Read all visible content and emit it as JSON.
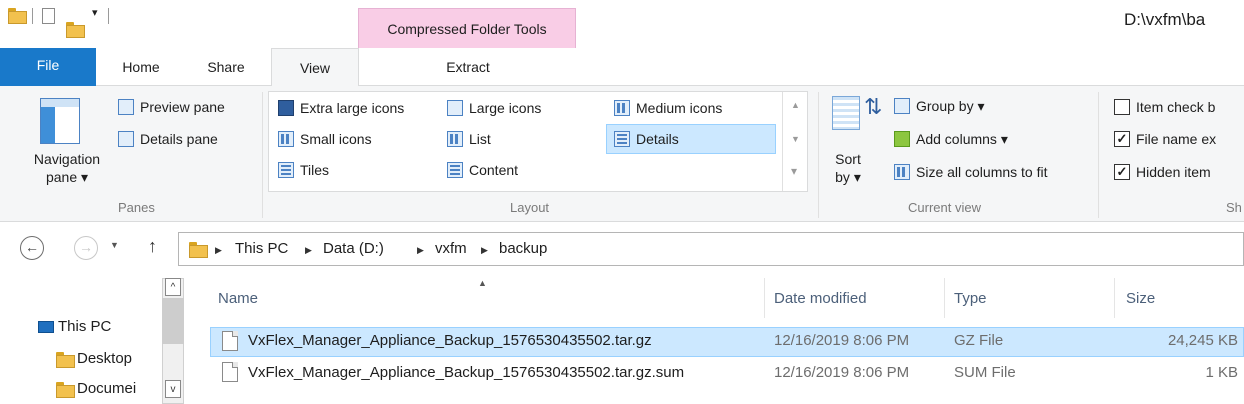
{
  "window": {
    "title": "D:\\vxfm\\ba",
    "context_tab": "Compressed Folder Tools"
  },
  "tabs": {
    "file": "File",
    "home": "Home",
    "share": "Share",
    "view": "View",
    "extract": "Extract"
  },
  "ribbon": {
    "panes": {
      "navigation_pane": "Navigation pane ▾",
      "preview_pane": "Preview pane",
      "details_pane": "Details pane",
      "label": "Panes"
    },
    "layout": {
      "extra_large_icons": "Extra large icons",
      "large_icons": "Large icons",
      "medium_icons": "Medium icons",
      "small_icons": "Small icons",
      "list": "List",
      "details": "Details",
      "tiles": "Tiles",
      "content": "Content",
      "label": "Layout",
      "selected": "Details"
    },
    "current_view": {
      "sort_by": "Sort by ▾",
      "group_by": "Group by ▾",
      "add_columns": "Add columns ▾",
      "size_all_columns": "Size all columns to fit",
      "label": "Current view"
    },
    "show_hide": {
      "item_check_boxes": "Item check b",
      "file_name_extensions": "File name ex",
      "hidden_items": "Hidden item",
      "label": "Sh",
      "item_check_boxes_checked": false,
      "file_name_extensions_checked": true,
      "hidden_items_checked": true
    }
  },
  "address": {
    "crumbs": [
      "This PC",
      "Data (D:)",
      "vxfm",
      "backup"
    ]
  },
  "nav_pane": {
    "items": [
      "This PC",
      "Desktop",
      "Documei"
    ]
  },
  "file_list": {
    "columns": [
      "Name",
      "Date modified",
      "Type",
      "Size"
    ],
    "rows": [
      {
        "name": "VxFlex_Manager_Appliance_Backup_1576530435502.tar.gz",
        "date": "12/16/2019 8:06 PM",
        "type": "GZ File",
        "size": "24,245 KB",
        "selected": true
      },
      {
        "name": "VxFlex_Manager_Appliance_Backup_1576530435502.tar.gz.sum",
        "date": "12/16/2019 8:06 PM",
        "type": "SUM File",
        "size": "1 KB",
        "selected": false
      }
    ]
  },
  "colors": {
    "file_tab": "#1979ca",
    "context_tab": "#f9cde6",
    "selection": "#cce8ff",
    "selection_border": "#99d1ff"
  }
}
